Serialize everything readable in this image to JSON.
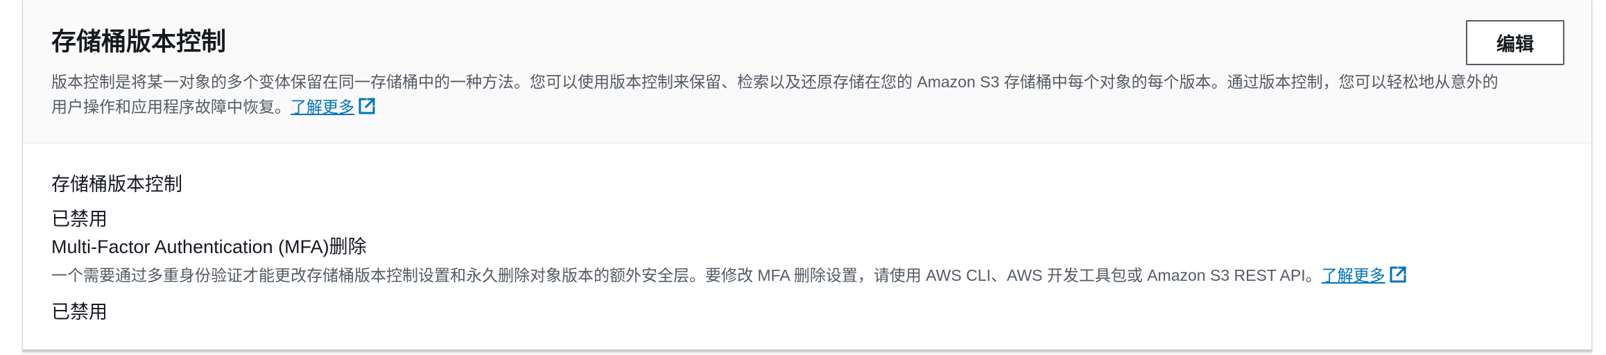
{
  "header": {
    "title": "存储桶版本控制",
    "edit_label": "编辑",
    "description_line1": "版本控制是将某一对象的多个变体保留在同一存储桶中的一种方法。您可以使用版本控制来保留、检索以及还原存储在您的 Amazon S3 存储桶中每个对象的每个版本。通过版本控制，您可以轻松地从意外的",
    "description_line2": "用户操作和应用程序故障中恢复。",
    "learn_more": "了解更多"
  },
  "versioning": {
    "label": "存储桶版本控制",
    "status": "已禁用"
  },
  "mfa_delete": {
    "label": "Multi-Factor Authentication (MFA)删除",
    "description": "一个需要通过多重身份验证才能更改存储桶版本控制设置和永久删除对象版本的额外安全层。要修改 MFA 删除设置，请使用 AWS CLI、AWS 开发工具包或 Amazon S3 REST API。",
    "learn_more": "了解更多",
    "status": "已禁用"
  },
  "colors": {
    "link": "#0073bb",
    "text": "#16191f",
    "secondary_text": "#545b64",
    "header_bg": "#fafafa"
  },
  "icons": {
    "external_link": "external-link-icon"
  }
}
